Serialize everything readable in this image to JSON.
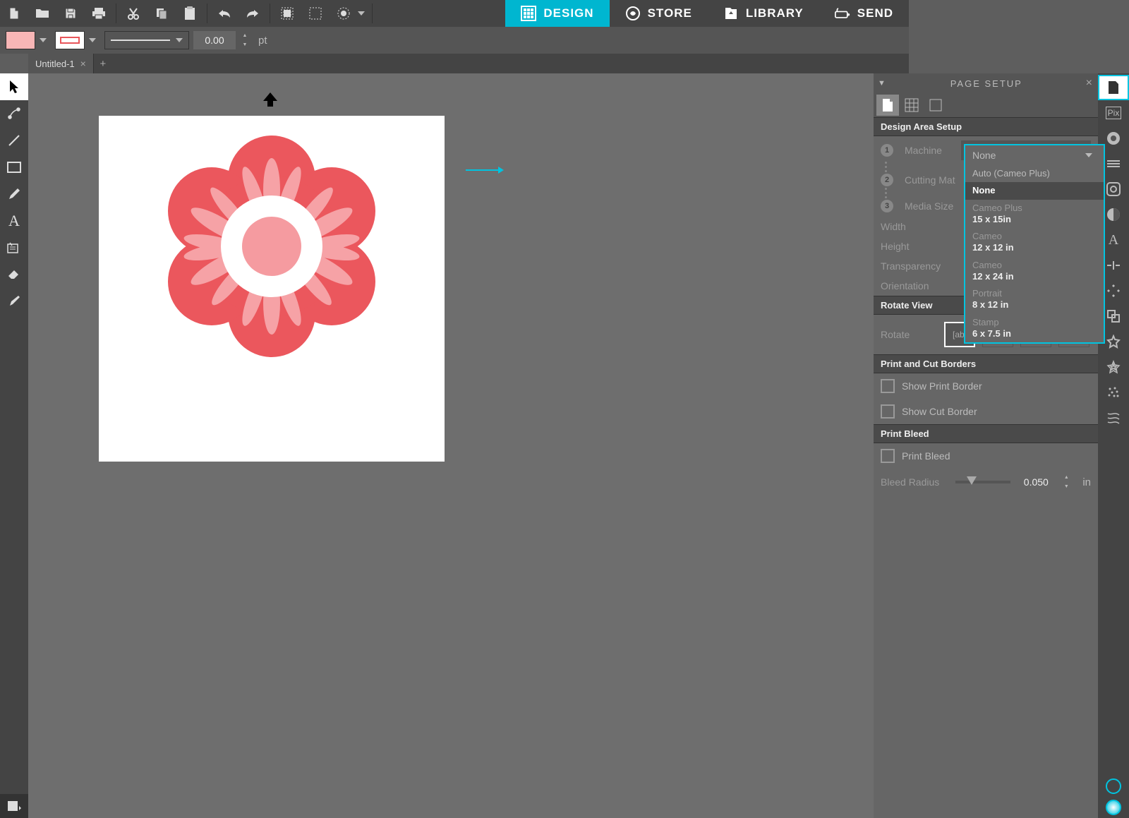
{
  "nav": {
    "design": "DESIGN",
    "store": "STORE",
    "library": "LIBRARY",
    "send": "SEND"
  },
  "sub": {
    "stroke_width": "0.00",
    "unit": "pt"
  },
  "tab": {
    "name": "Untitled-1"
  },
  "panel": {
    "title": "PAGE SETUP",
    "section_design": "Design Area Setup",
    "machine_lbl": "Machine",
    "machine_val": "Auto (Cameo Plus)",
    "cutting_lbl": "Cutting Mat",
    "media_lbl": "Media Size",
    "width_lbl": "Width",
    "height_lbl": "Height",
    "trans_lbl": "Transparency",
    "orient_lbl": "Orientation",
    "rotate_section": "Rotate View",
    "rotate_lbl": "Rotate",
    "print_section": "Print and Cut Borders",
    "show_print": "Show Print Border",
    "show_cut": "Show Cut Border",
    "bleed_section": "Print Bleed",
    "bleed_lbl": "Print Bleed",
    "bleed_radius_lbl": "Bleed Radius",
    "bleed_val": "0.050",
    "bleed_unit": "in"
  },
  "dropdown": {
    "head": "None",
    "opt0": "Auto (Cameo Plus)",
    "opt1": "None",
    "opt2_n": "Cameo Plus",
    "opt2_s": "15 x 15in",
    "opt3_n": "Cameo",
    "opt3_s": "12 x 12 in",
    "opt4_n": "Cameo",
    "opt4_s": "12 x 24 in",
    "opt5_n": "Portrait",
    "opt5_s": "8 x 12 in",
    "opt6_n": "Stamp",
    "opt6_s": "6 x 7.5 in"
  },
  "right": {
    "pix": "Pix"
  },
  "rot": {
    "ab": "ab"
  }
}
